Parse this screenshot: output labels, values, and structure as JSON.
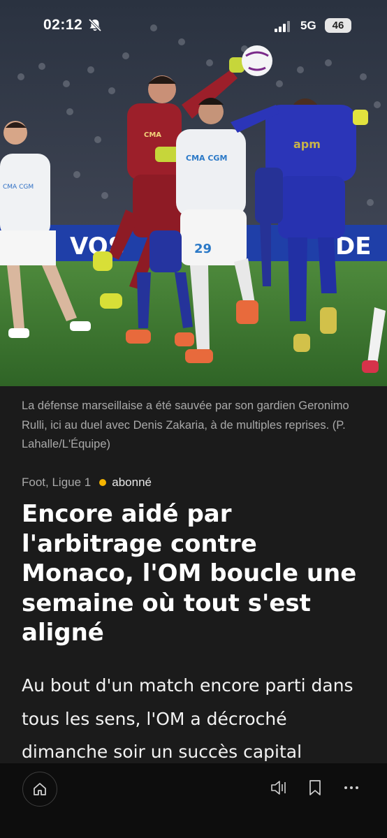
{
  "status": {
    "time": "02:12",
    "network": "5G",
    "battery": "46"
  },
  "photo": {
    "description_icons": [
      "mute-bell-icon"
    ],
    "banner_text": "VOS",
    "banner_text_right": "DE",
    "jersey_text_keeper": "CMA",
    "jersey_text_om": "CMA CGM",
    "jersey_text_monaco": "apm",
    "player_number": "29"
  },
  "article": {
    "caption": "La défense marseillaise a été sauvée par son gardien Geronimo Rulli, ici au duel avec Denis Zakaria, à de multiples reprises. (P. Lahalle/L'Équipe)",
    "section": "Foot, Ligue 1",
    "badge": "abonné",
    "headline": "Encore aidé par l'arbitrage contre Monaco, l'OM boucle une semaine où tout s'est aligné",
    "lede": "Au bout d'un match encore parti dans tous les sens, l'OM a décroché dimanche soir un succès capital"
  },
  "colors": {
    "background": "#1b1b1b",
    "bottom_bar": "#0d0d0d",
    "badge_dot": "#f4b400",
    "caption_text": "#a9a9a9"
  }
}
